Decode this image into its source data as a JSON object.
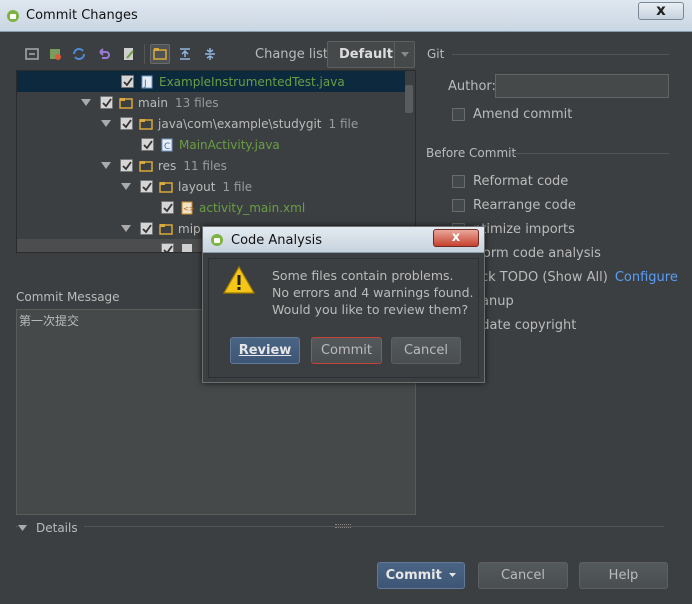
{
  "window": {
    "title": "Commit Changes"
  },
  "toolbar": {
    "changelist_label": "Change list:",
    "changelist_value": "Default"
  },
  "tree": {
    "rows": [
      {
        "name": "ExampleInstrumentedTest.java",
        "count": ""
      },
      {
        "name": "main",
        "count": "13 files"
      },
      {
        "name": "java\\com\\example\\studygit",
        "count": "1 file"
      },
      {
        "name": "MainActivity.java",
        "count": ""
      },
      {
        "name": "res",
        "count": "11 files"
      },
      {
        "name": "layout",
        "count": "1 file"
      },
      {
        "name": "activity_main.xml",
        "count": ""
      },
      {
        "name": "mip",
        "count": ""
      }
    ]
  },
  "commit_message": {
    "label": "Commit Message",
    "value": "第一次提交"
  },
  "details_label": "Details",
  "git": {
    "section_label": "Git",
    "author_label": "Author:",
    "author_value": "",
    "amend_label": "Amend commit"
  },
  "before_commit": {
    "section_label": "Before Commit",
    "options": [
      {
        "label": "Reformat code",
        "checked": false
      },
      {
        "label": "Rearrange code",
        "checked": false
      },
      {
        "label": "ptimize imports",
        "checked": false
      },
      {
        "label": "rform code analysis",
        "checked": true
      },
      {
        "label": "eck TODO (Show All)",
        "checked": true
      },
      {
        "label": "eanup",
        "checked": false
      },
      {
        "label": "pdate copyright",
        "checked": false
      }
    ],
    "configure_link": "Configure"
  },
  "buttons": {
    "commit": "Commit",
    "cancel": "Cancel",
    "help": "Help"
  },
  "analysis_dialog": {
    "title": "Code Analysis",
    "lines": [
      "Some files contain problems.",
      "No errors and 4 warnings found.",
      "Would you like to review them?"
    ],
    "review": "Review",
    "commit": "Commit",
    "cancel": "Cancel"
  },
  "colors": {
    "background": "#3c3f41",
    "link": "#589df6",
    "selection": "#0d293e",
    "added_file": "#6a9e43"
  }
}
